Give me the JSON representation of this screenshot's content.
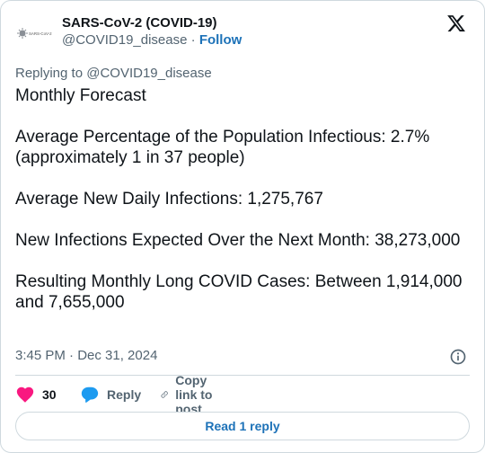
{
  "author": {
    "display_name": "SARS-CoV-2 (COVID-19)",
    "handle": "@COVID19_disease",
    "separator": "·",
    "follow_label": "Follow",
    "avatar_text": "SARS-CoV-2",
    "avatar_icon": "virus-icon"
  },
  "reply_to": "Replying to @COVID19_disease",
  "tweet": {
    "paragraphs": [
      "Monthly Forecast",
      "Average Percentage of the Population Infectious: 2.7% (approximately 1 in 37 people)",
      "Average New Daily Infections: 1,275,767",
      "New Infections Expected Over the Next Month: 38,273,000",
      "Resulting Monthly Long COVID Cases: Between 1,914,000 and 7,655,000"
    ]
  },
  "meta": {
    "timestamp": "3:45 PM · Dec 31, 2024",
    "info_icon": "info-icon"
  },
  "actions": {
    "like_count": "30",
    "reply_label": "Reply",
    "copy_label": "Copy link to post"
  },
  "read_replies_label": "Read 1 reply",
  "colors": {
    "like": "#f91880",
    "reply": "#1d9bf0",
    "link": "#1d72b8",
    "muted": "#536471",
    "border": "#cfd9de"
  }
}
